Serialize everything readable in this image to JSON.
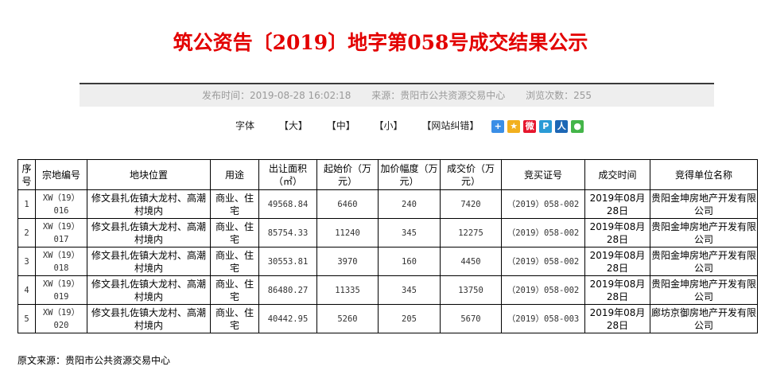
{
  "page": {
    "title": "筑公资告〔2019〕地字第058号成交结果公示"
  },
  "meta": {
    "publish_time": "发布时间：2019-08-28 16:02:18",
    "source": "来源：贵阳市公共资源交易中心",
    "views": "浏览次数：255"
  },
  "toolbar": {
    "font_label": "字体",
    "large": "【大】",
    "medium": "【中】",
    "small": "【小】",
    "report_error": "【网站纠错】",
    "share_icons": [
      {
        "name": "share-more-icon",
        "color": "#3a8ee6"
      },
      {
        "name": "qzone-icon",
        "color": "#f2b01e"
      },
      {
        "name": "weibo-icon",
        "color": "#e6162d"
      },
      {
        "name": "tencent-weibo-icon",
        "color": "#2a9bd6"
      },
      {
        "name": "renren-icon",
        "color": "#1d67b5"
      },
      {
        "name": "wechat-icon",
        "color": "#44b549"
      }
    ]
  },
  "table": {
    "headers": [
      "序号",
      "宗地编号",
      "地块位置",
      "用途",
      "出让面积（㎡）",
      "起始价（万元）",
      "加价幅度（万元）",
      "成交价（万元）",
      "竞买证号",
      "成交时间",
      "竞得单位名称"
    ],
    "rows": [
      [
        "1",
        "XW（19）016",
        "修文县扎佐镇大龙村、高潮村境内",
        "商业、住宅",
        "49568.84",
        "6460",
        "240",
        "7420",
        "（2019）058-002",
        "2019年08月28日",
        "贵阳金坤房地产开发有限公司"
      ],
      [
        "2",
        "XW（19）017",
        "修文县扎佐镇大龙村、高潮村境内",
        "商业、住宅",
        "85754.33",
        "11240",
        "345",
        "12275",
        "（2019）058-002",
        "2019年08月28日",
        "贵阳金坤房地产开发有限公司"
      ],
      [
        "3",
        "XW（19）018",
        "修文县扎佐镇大龙村、高潮村境内",
        "商业、住宅",
        "30553.81",
        "3970",
        "160",
        "4450",
        "（2019）058-002",
        "2019年08月28日",
        "贵阳金坤房地产开发有限公司"
      ],
      [
        "4",
        "XW（19）019",
        "修文县扎佐镇大龙村、高潮村境内",
        "商业、住宅",
        "86480.27",
        "11335",
        "345",
        "13750",
        "（2019）058-002",
        "2019年08月28日",
        "贵阳金坤房地产开发有限公司"
      ],
      [
        "5",
        "XW（19）020",
        "修文县扎佐镇大龙村、高潮村境内",
        "商业、住宅",
        "40442.95",
        "5260",
        "205",
        "5670",
        "（2019）058-003",
        "2019年08月28日",
        "廊坊京御房地产开发有限公司"
      ]
    ]
  },
  "footer": {
    "source": "原文来源：贵阳市公共资源交易中心"
  }
}
